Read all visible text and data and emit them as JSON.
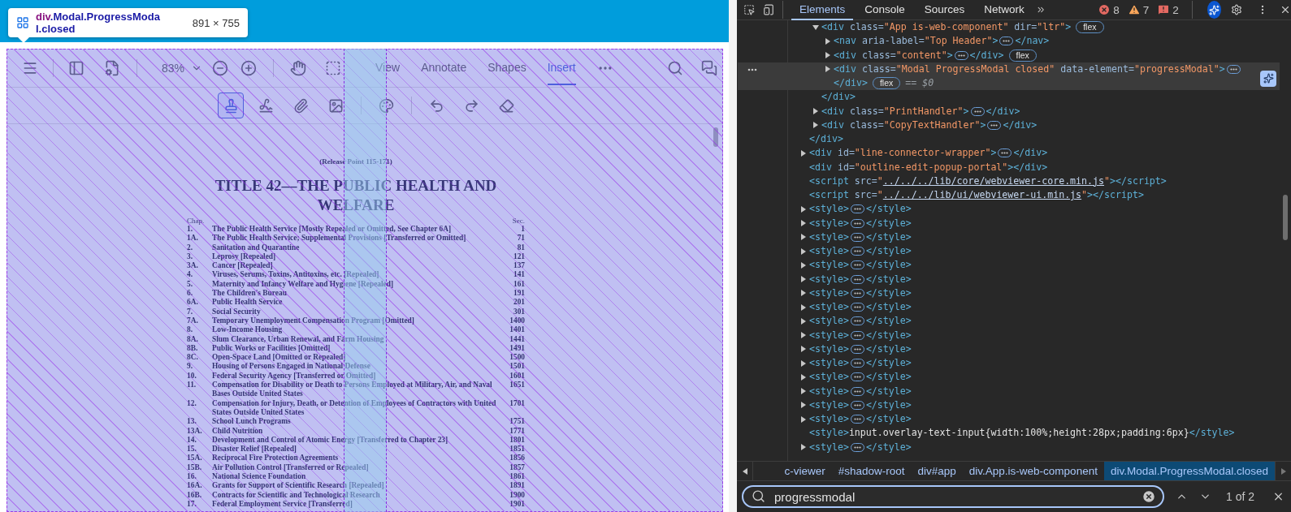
{
  "tooltip": {
    "tag": "div",
    "classes": ".Modal.ProgressModal.closed",
    "size": "891 × 755"
  },
  "viewer": {
    "zoom": "83%",
    "tabs": [
      {
        "label": "View",
        "selected": false
      },
      {
        "label": "Annotate",
        "selected": false
      },
      {
        "label": "Shapes",
        "selected": false
      },
      {
        "label": "Insert",
        "selected": true
      }
    ],
    "tools": [
      {
        "selected": true
      },
      {
        "selected": false
      },
      {
        "selected": false
      },
      {
        "selected": false
      },
      {
        "selected": false
      },
      {
        "selected": false
      },
      {
        "selected": false
      },
      {
        "selected": false
      }
    ],
    "document": {
      "release": "(Release Point 115-171)",
      "title": "TITLE 42—THE PUBLIC HEALTH AND WELFARE",
      "chap_heading": "Chap.",
      "sec_heading": "Sec.",
      "chapters": [
        {
          "chap": "1.",
          "title": "The Public Health Service [Mostly Repealed or Omitted, See Chapter 6A]",
          "sec": "1"
        },
        {
          "chap": "1A.",
          "title": "The Public Health Service; Supplemental Provisions [Transferred or Omitted]",
          "sec": "71"
        },
        {
          "chap": "2.",
          "title": "Sanitation and Quarantine",
          "sec": "81"
        },
        {
          "chap": "3.",
          "title": "Leprosy [Repealed]",
          "sec": "121"
        },
        {
          "chap": "3A.",
          "title": "Cancer [Repealed]",
          "sec": "137"
        },
        {
          "chap": "4.",
          "title": "Viruses, Serums, Toxins, Antitoxins, etc. [Repealed]",
          "sec": "141"
        },
        {
          "chap": "5.",
          "title": "Maternity and Infancy Welfare and Hygiene [Repealed]",
          "sec": "161"
        },
        {
          "chap": "6.",
          "title": "The Children's Bureau",
          "sec": "191"
        },
        {
          "chap": "6A.",
          "title": "Public Health Service",
          "sec": "201"
        },
        {
          "chap": "7.",
          "title": "Social Security",
          "sec": "301"
        },
        {
          "chap": "7A.",
          "title": "Temporary Unemployment Compensation Program [Omitted]",
          "sec": "1400"
        },
        {
          "chap": "8.",
          "title": "Low-Income Housing",
          "sec": "1401"
        },
        {
          "chap": "8A.",
          "title": "Slum Clearance, Urban Renewal, and Farm Housing",
          "sec": "1441"
        },
        {
          "chap": "8B.",
          "title": "Public Works or Facilities [Omitted]",
          "sec": "1491"
        },
        {
          "chap": "8C.",
          "title": "Open-Space Land [Omitted or Repealed]",
          "sec": "1500"
        },
        {
          "chap": "9.",
          "title": "Housing of Persons Engaged in National Defense",
          "sec": "1501"
        },
        {
          "chap": "10.",
          "title": "Federal Security Agency [Transferred or Omitted]",
          "sec": "1601"
        },
        {
          "chap": "11.",
          "title": "Compensation for Disability or Death to Persons Employed at Military, Air, and Naval Bases Outside United States",
          "sec": "1651"
        },
        {
          "chap": "12.",
          "title": "Compensation for Injury, Death, or Detention of Employees of Contractors with United States Outside United States",
          "sec": "1701"
        },
        {
          "chap": "13.",
          "title": "School Lunch Programs",
          "sec": "1751"
        },
        {
          "chap": "13A.",
          "title": "Child Nutrition",
          "sec": "1771"
        },
        {
          "chap": "14.",
          "title": "Development and Control of Atomic Energy [Transferred to Chapter 23]",
          "sec": "1801"
        },
        {
          "chap": "15.",
          "title": "Disaster Relief [Repealed]",
          "sec": "1851"
        },
        {
          "chap": "15A.",
          "title": "Reciprocal Fire Protection Agreements",
          "sec": "1856"
        },
        {
          "chap": "15B.",
          "title": "Air Pollution Control [Transferred or Repealed]",
          "sec": "1857"
        },
        {
          "chap": "16.",
          "title": "National Science Foundation",
          "sec": "1861"
        },
        {
          "chap": "16A.",
          "title": "Grants for Support of Scientific Research [Repealed]",
          "sec": "1891"
        },
        {
          "chap": "16B.",
          "title": "Contracts for Scientific and Technological Research",
          "sec": "1900"
        },
        {
          "chap": "17.",
          "title": "Federal Employment Service [Transferred]",
          "sec": "1901"
        }
      ]
    }
  },
  "devtools": {
    "tabs": [
      {
        "label": "Elements",
        "selected": true
      },
      {
        "label": "Console",
        "selected": false
      },
      {
        "label": "Sources",
        "selected": false
      },
      {
        "label": "Network",
        "selected": false
      }
    ],
    "counts": [
      {
        "kind": "error",
        "count": "8"
      },
      {
        "kind": "warning",
        "count": "7"
      },
      {
        "kind": "issue",
        "count": "2"
      }
    ],
    "tree": [
      {
        "selected": false,
        "close": "</div>",
        "children": [
          {
            "open": "<div class=\"App is-web-component\" dir=\"ltr\">",
            "expanded": true,
            "badge": "flex",
            "close": "</div>",
            "selected": false,
            "children": [
              {
                "open": "<nav aria-label=\"Top Header\">",
                "expanded": false,
                "close": "</nav>",
                "selected": false
              },
              {
                "open": "<div class=\"content\">",
                "expanded": false,
                "close": "</div>",
                "badge": "flex",
                "selected": false
              },
              {
                "open": "<div class=\"Modal ProgressModal closed\" data-element=\"progressModal\">",
                "expanded": false,
                "close": "</div>",
                "badge": "flex",
                "ref": "== $0",
                "selected": true
              }
            ]
          },
          {
            "open": "<div class=\"PrintHandler\">",
            "expanded": false,
            "close": "</div>",
            "selected": false
          },
          {
            "open": "<div class=\"CopyTextHandler\">",
            "expanded": false,
            "close": "</div>",
            "selected": false
          }
        ]
      },
      {
        "open": "<div id=\"line-connector-wrapper\">",
        "expanded": false,
        "close": "</div>",
        "selected": false
      },
      {
        "open": "<div id=\"outline-edit-popup-portal\">",
        "close": "</div>",
        "selected": false
      },
      {
        "open": "<script src=\"../../../lib/core/webviewer-core.min.js\">",
        "close": "</script>",
        "link": true,
        "selected": false
      },
      {
        "open": "<script src=\"../../../lib/ui/webviewer-ui.min.js\">",
        "close": "</script>",
        "link": true,
        "selected": false
      },
      {
        "open": "<style>",
        "expanded": false,
        "close": "</style>",
        "selected": false
      },
      {
        "open": "<style>",
        "expanded": false,
        "close": "</style>",
        "selected": false
      },
      {
        "open": "<style>",
        "expanded": false,
        "close": "</style>",
        "selected": false
      },
      {
        "open": "<style>",
        "expanded": false,
        "close": "</style>",
        "selected": false
      },
      {
        "open": "<style>",
        "expanded": false,
        "close": "</style>",
        "selected": false
      },
      {
        "open": "<style>",
        "expanded": false,
        "close": "</style>",
        "selected": false
      },
      {
        "open": "<style>",
        "expanded": false,
        "close": "</style>",
        "selected": false
      },
      {
        "open": "<style>",
        "expanded": false,
        "close": "</style>",
        "selected": false
      },
      {
        "open": "<style>",
        "expanded": false,
        "close": "</style>",
        "selected": false
      },
      {
        "open": "<style>",
        "expanded": false,
        "close": "</style>",
        "selected": false
      },
      {
        "open": "<style>",
        "expanded": false,
        "close": "</style>",
        "selected": false
      },
      {
        "open": "<style>",
        "expanded": false,
        "close": "</style>",
        "selected": false
      },
      {
        "open": "<style>",
        "expanded": false,
        "close": "</style>",
        "selected": false
      },
      {
        "open": "<style>",
        "expanded": false,
        "close": "</style>",
        "selected": false
      },
      {
        "open": "<style>",
        "expanded": false,
        "close": "</style>",
        "selected": false
      },
      {
        "open": "<style>",
        "expanded": false,
        "close": "</style>",
        "selected": false
      },
      {
        "open": "<style>",
        "text": "input.overlay-text-input{width:100%;height:28px;padding:6px}",
        "close": "</style>",
        "selected": false
      },
      {
        "open": "<style>",
        "expanded": false,
        "close": "</style>",
        "selected": false
      }
    ],
    "breadcrumbs": [
      {
        "label": "c-viewer",
        "selected": false
      },
      {
        "label": "#shadow-root",
        "selected": false
      },
      {
        "label": "div#app",
        "selected": false
      },
      {
        "label": "div.App.is-web-component",
        "selected": false
      },
      {
        "label": "div.Modal.ProgressModal.closed",
        "selected": true
      }
    ],
    "search": {
      "value": "progressmodal",
      "result": "1 of 2"
    }
  }
}
